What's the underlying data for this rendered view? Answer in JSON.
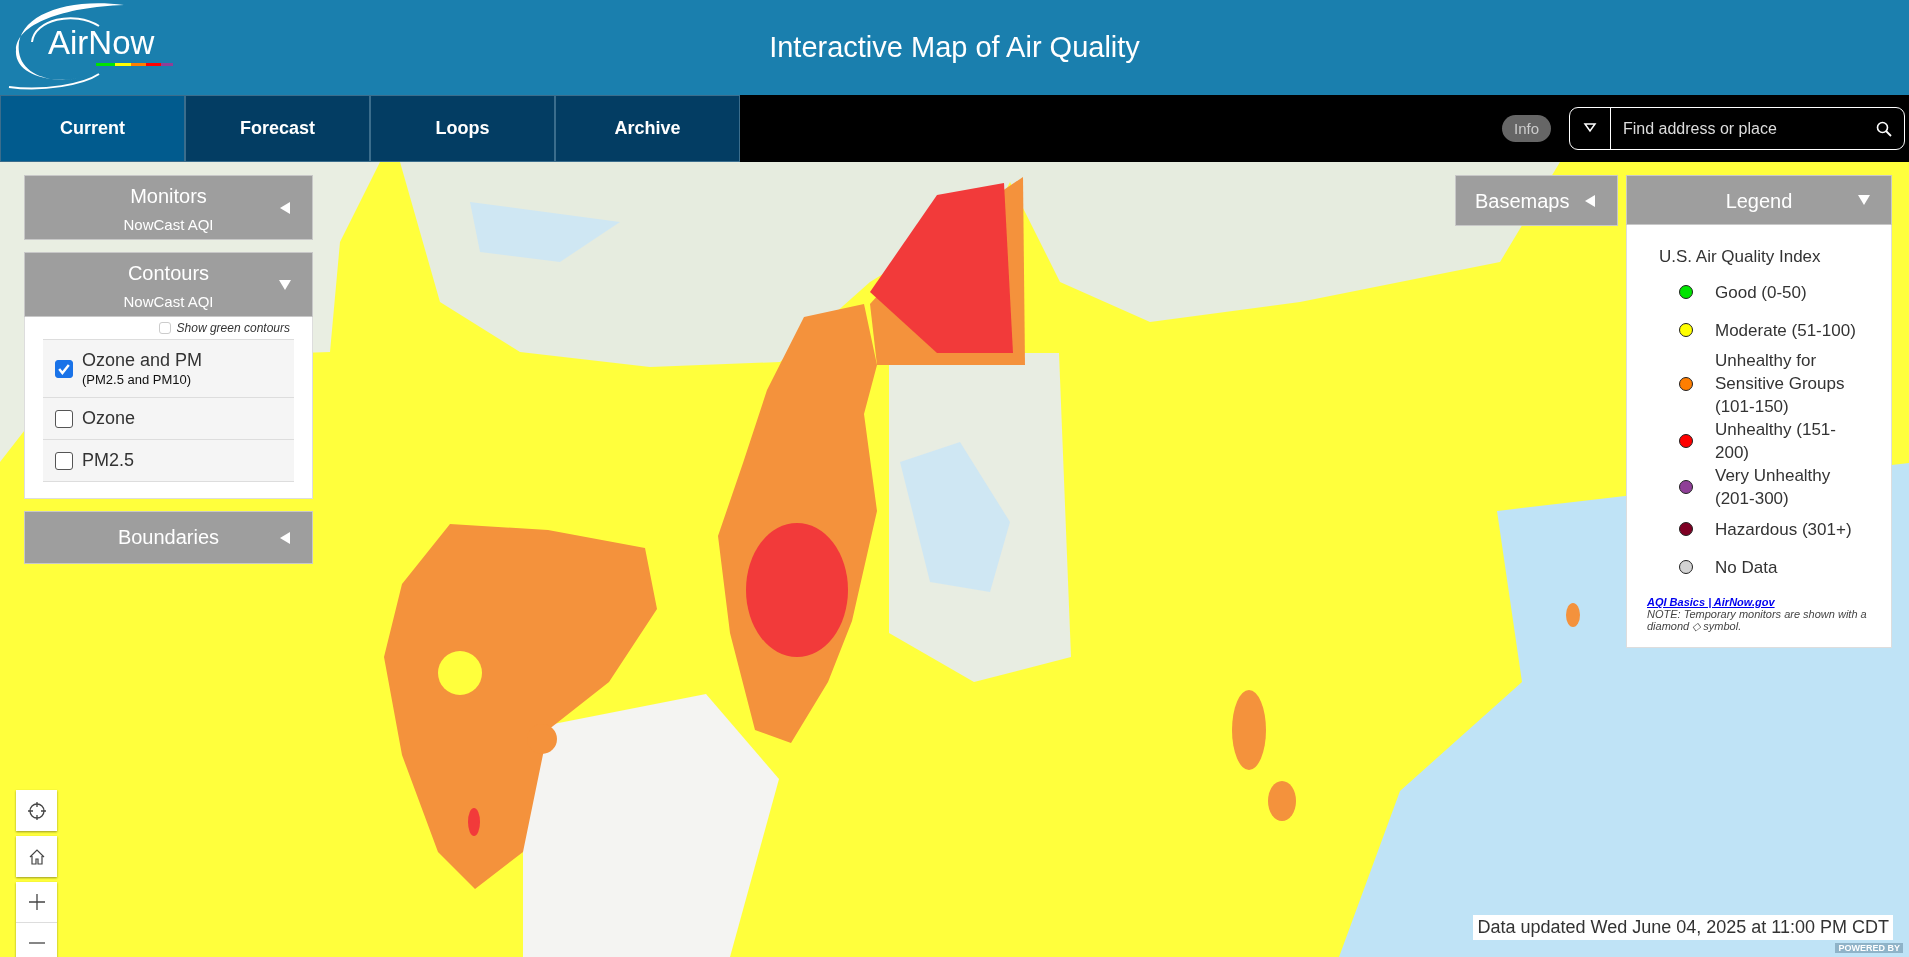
{
  "header": {
    "logo": "AirNow",
    "title": "Interactive Map of Air Quality"
  },
  "tabs": [
    {
      "label": "Current",
      "selected": true
    },
    {
      "label": "Forecast",
      "selected": false
    },
    {
      "label": "Loops",
      "selected": false
    },
    {
      "label": "Archive",
      "selected": false
    }
  ],
  "info_button": "Info",
  "search": {
    "placeholder": "Find address or place"
  },
  "panels": [
    {
      "title": "Monitors",
      "subtitle": "NowCast AQI",
      "expanded": false
    },
    {
      "title": "Contours",
      "subtitle": "NowCast AQI",
      "expanded": true,
      "show_green_contours": {
        "label": "Show green contours",
        "checked": false
      },
      "options": [
        {
          "label": "Ozone and PM",
          "sublabel": "(PM2.5 and PM10)",
          "checked": true
        },
        {
          "label": "Ozone",
          "checked": false
        },
        {
          "label": "PM2.5",
          "checked": false
        }
      ]
    },
    {
      "title": "Boundaries",
      "expanded": false
    }
  ],
  "basemaps": {
    "title": "Basemaps",
    "expanded": false
  },
  "legend": {
    "title": "Legend",
    "expanded": true,
    "heading": "U.S. Air Quality Index",
    "items": [
      {
        "label": "Good (0-50)",
        "color": "#00e400"
      },
      {
        "label": "Moderate (51-100)",
        "color": "#ffff00"
      },
      {
        "label": "Unhealthy for Sensitive Groups (101-150)",
        "color": "#ff7e00"
      },
      {
        "label": "Unhealthy (151-200)",
        "color": "#ff0000"
      },
      {
        "label": "Very Unhealthy (201-300)",
        "color": "#8f3f97"
      },
      {
        "label": "Hazardous (301+)",
        "color": "#7e0023"
      },
      {
        "label": "No Data",
        "color": "#d3d3d3"
      }
    ],
    "link": "AQI Basics | AirNow.gov",
    "note": "NOTE: Temporary monitors are shown with a diamond ◇ symbol."
  },
  "status": "Data updated Wed June 04, 2025 at 11:00 PM CDT",
  "attribution": "POWERED BY"
}
